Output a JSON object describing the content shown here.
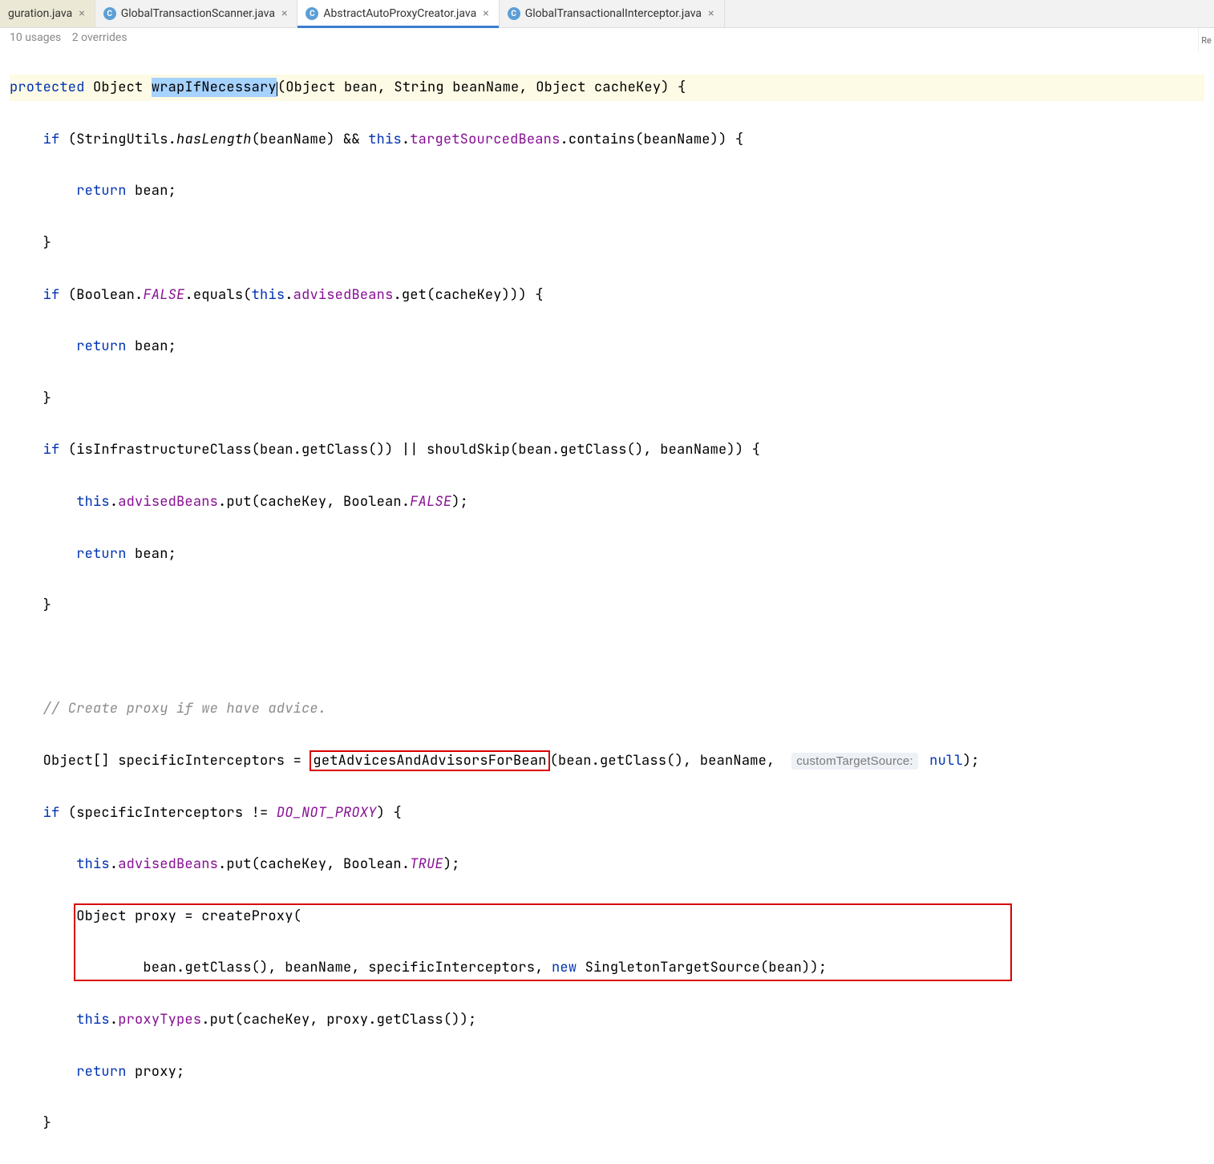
{
  "tabs": [
    {
      "label": "guration.java"
    },
    {
      "label": "GlobalTransactionScanner.java"
    },
    {
      "label": "AbstractAutoProxyCreator.java"
    },
    {
      "label": "GlobalTransactionalInterceptor.java"
    }
  ],
  "usages": {
    "usages_text": "10 usages",
    "overrides_text": "2 overrides"
  },
  "right_label": "Re",
  "code": {
    "protected": "protected",
    "object": "Object",
    "wrapIfNecessary": "wrapIfNecessary",
    "sig_params": "(Object bean, String beanName, Object cacheKey) {",
    "if": "if",
    "stringutils": "StringUtils",
    "hasLength": "hasLength",
    "p_beanName": "(beanName) && ",
    "this": "this",
    "dot": ".",
    "targetSourcedBeans": "targetSourcedBeans",
    "contains": ".contains(beanName)) {",
    "return": "return",
    "bean_semi": " bean;",
    "close_brace": "}",
    "Boolean": "Boolean",
    "FALSE": "FALSE",
    "equals": ".equals(",
    "advisedBeans": "advisedBeans",
    "get_cachekey": ".get(cacheKey))) {",
    "infra_line": " (isInfrastructureClass(bean.getClass()) || shouldSkip(bean.getClass(), beanName)) {",
    "put_cachekey_false_a": ".put(cacheKey, Boolean.",
    "put_close": ");",
    "comment_create": "// Create proxy if we have advice.",
    "specificInterceptors_decl": "Object[] specificInterceptors = ",
    "getAdvicesAndAdvisorsForBean": "getAdvicesAndAdvisorsForBean",
    "cust_targetsource": "customTargetSource:",
    "after_advices": "(bean.getClass(), beanName, ",
    "null_close": "null);",
    "null_kw": "null",
    "do_not_proxy_pre": " (specificInterceptors != ",
    "DO_NOT_PROXY": "DO_NOT_PROXY",
    "do_not_proxy_post": ") {",
    "TRUE": "TRUE",
    "createProxy_line": "Object proxy = createProxy(",
    "createProxy_args_a": "bean.getClass(), beanName, specificInterceptors, ",
    "new": "new",
    "singleton": " SingletonTargetSource(bean));",
    "proxyTypes": "proxyTypes",
    "proxyTypes_args": ".put(cacheKey, proxy.getClass());",
    "return_proxy": " proxy;"
  }
}
